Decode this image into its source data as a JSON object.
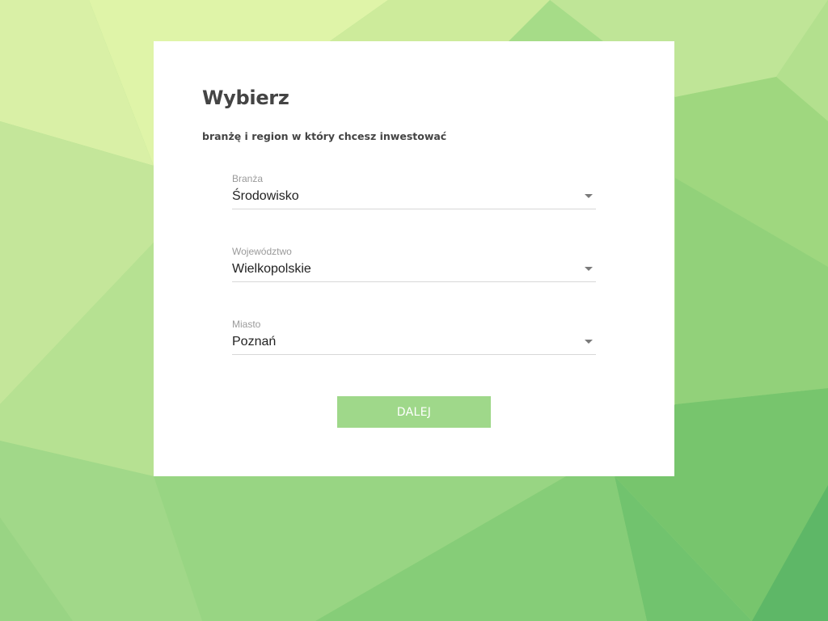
{
  "form": {
    "title": "Wybierz",
    "subtitle": "branżę i region w który chcesz inwestować",
    "fields": [
      {
        "label": "Branża",
        "value": "Środowisko"
      },
      {
        "label": "Województwo",
        "value": "Wielkopolskie"
      },
      {
        "label": "Miasto",
        "value": "Poznań"
      }
    ],
    "submit_label": "DALEJ"
  },
  "colors": {
    "accent": "#9fd88a",
    "text_dark": "#444444",
    "label_gray": "#9a9a9a"
  },
  "icons": [
    "dropdown-caret-icon"
  ]
}
